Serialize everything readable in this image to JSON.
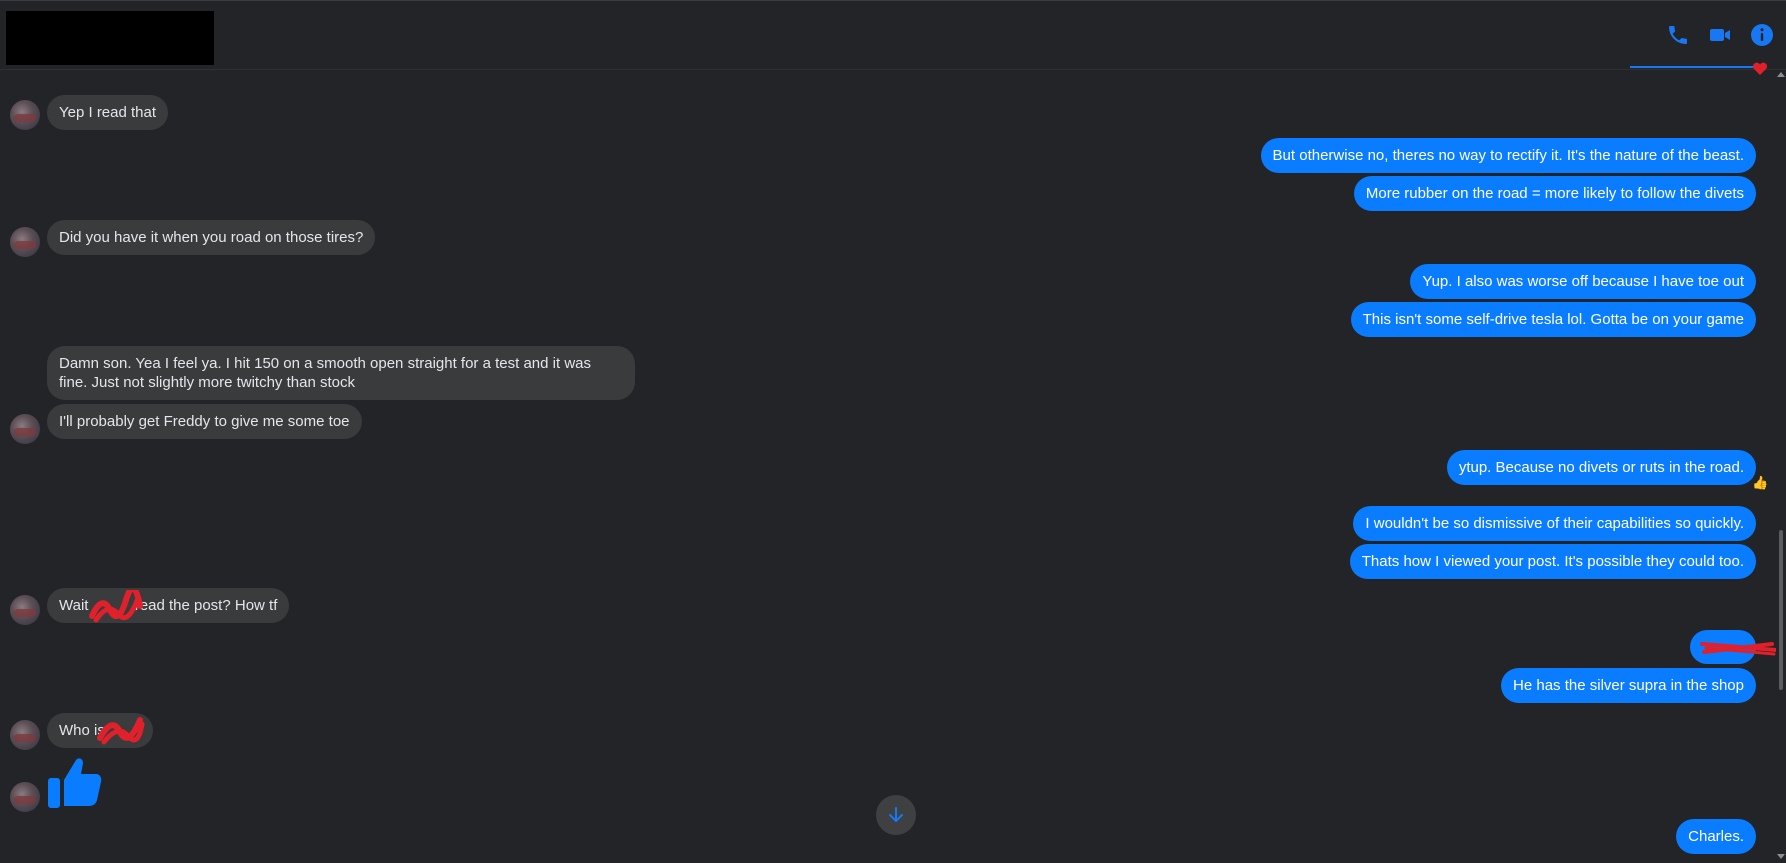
{
  "header": {
    "icons": [
      "phone-icon",
      "video-camera-icon",
      "info-icon"
    ]
  },
  "messages": [
    {
      "side": "in",
      "text": "Yep I read that"
    },
    {
      "side": "out",
      "text": "But otherwise no, theres no way to rectify it. It's the nature of the beast."
    },
    {
      "side": "out",
      "text": "More rubber on the road = more likely to follow the divets"
    },
    {
      "side": "in",
      "text": "Did you have it when you road on those tires?"
    },
    {
      "side": "out",
      "text": "Yup. I also was worse off because I have toe out"
    },
    {
      "side": "out",
      "text": "This isn't some self-drive tesla lol. Gotta be on your game"
    },
    {
      "side": "in",
      "text": "Damn son. Yea I feel ya. I hit 150 on a smooth open straight for a test and it was fine. Just not slightly more twitchy than stock"
    },
    {
      "side": "in",
      "text": "I'll probably get Freddy to give me some toe"
    },
    {
      "side": "out",
      "text": "ytup. Because no divets or ruts in the road."
    },
    {
      "side": "out",
      "text": "I wouldn't be so dismissive of their capabilities so quickly."
    },
    {
      "side": "out",
      "text": "Thats how I viewed your post. It's possible they could too."
    },
    {
      "side": "in",
      "text_before": "Wait ",
      "text_after": " read the post? How tf"
    },
    {
      "side": "out",
      "text": ""
    },
    {
      "side": "out",
      "text": "He has the silver supra in the shop"
    },
    {
      "side": "in",
      "text": "Who is "
    },
    {
      "side": "in",
      "sticker": "thumbs-up-icon"
    },
    {
      "side": "out",
      "text": "Charles."
    }
  ],
  "colors": {
    "accent": "#0a7cff",
    "incoming_bubble": "#3a3b3c",
    "background": "#232427",
    "redaction": "#e0202a"
  }
}
